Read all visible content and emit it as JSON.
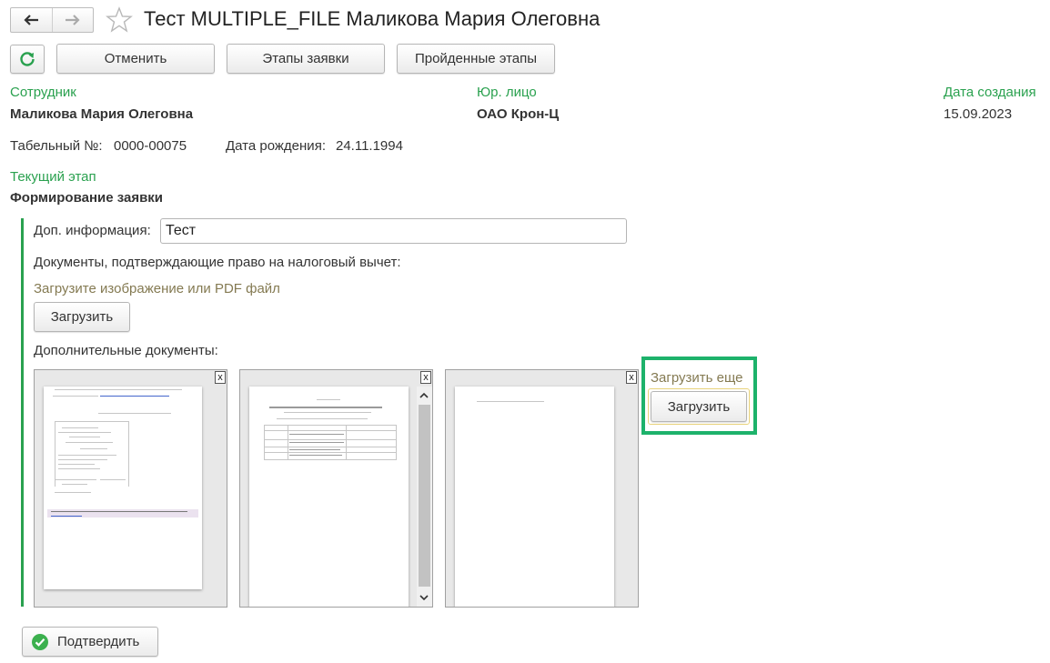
{
  "header": {
    "title": "Тест MULTIPLE_FILE Маликова Мария Олеговна"
  },
  "toolbar": {
    "cancel_label": "Отменить",
    "stages_label": "Этапы заявки",
    "passed_label": "Пройденные этапы"
  },
  "employee": {
    "label": "Сотрудник",
    "value": "Маликова Мария Олеговна",
    "tab_label": "Табельный №:",
    "tab_value": "0000-00075",
    "birth_label": "Дата рождения:",
    "birth_value": "24.11.1994"
  },
  "legal": {
    "label": "Юр. лицо",
    "value": "ОАО Крон-Ц"
  },
  "created": {
    "label": "Дата создания",
    "value": "15.09.2023"
  },
  "stage": {
    "label": "Текущий этап",
    "value": "Формирование заявки"
  },
  "form": {
    "extra_label": "Доп. информация:",
    "extra_value": "Тест",
    "docs_label": "Документы, подтверждающие право на налоговый вычет:",
    "upload_hint": "Загрузите изображение или PDF файл",
    "upload_label": "Загрузить",
    "additional_label": "Дополнительные документы:",
    "upload_more_hint": "Загрузить еще",
    "upload_more_label": "Загрузить",
    "close_label": "x"
  },
  "footer": {
    "confirm_label": "Подтвердить"
  },
  "colors": {
    "accent_green": "#2aa14f",
    "hint_olive": "#847a52",
    "highlight_box": "#1db26b"
  }
}
